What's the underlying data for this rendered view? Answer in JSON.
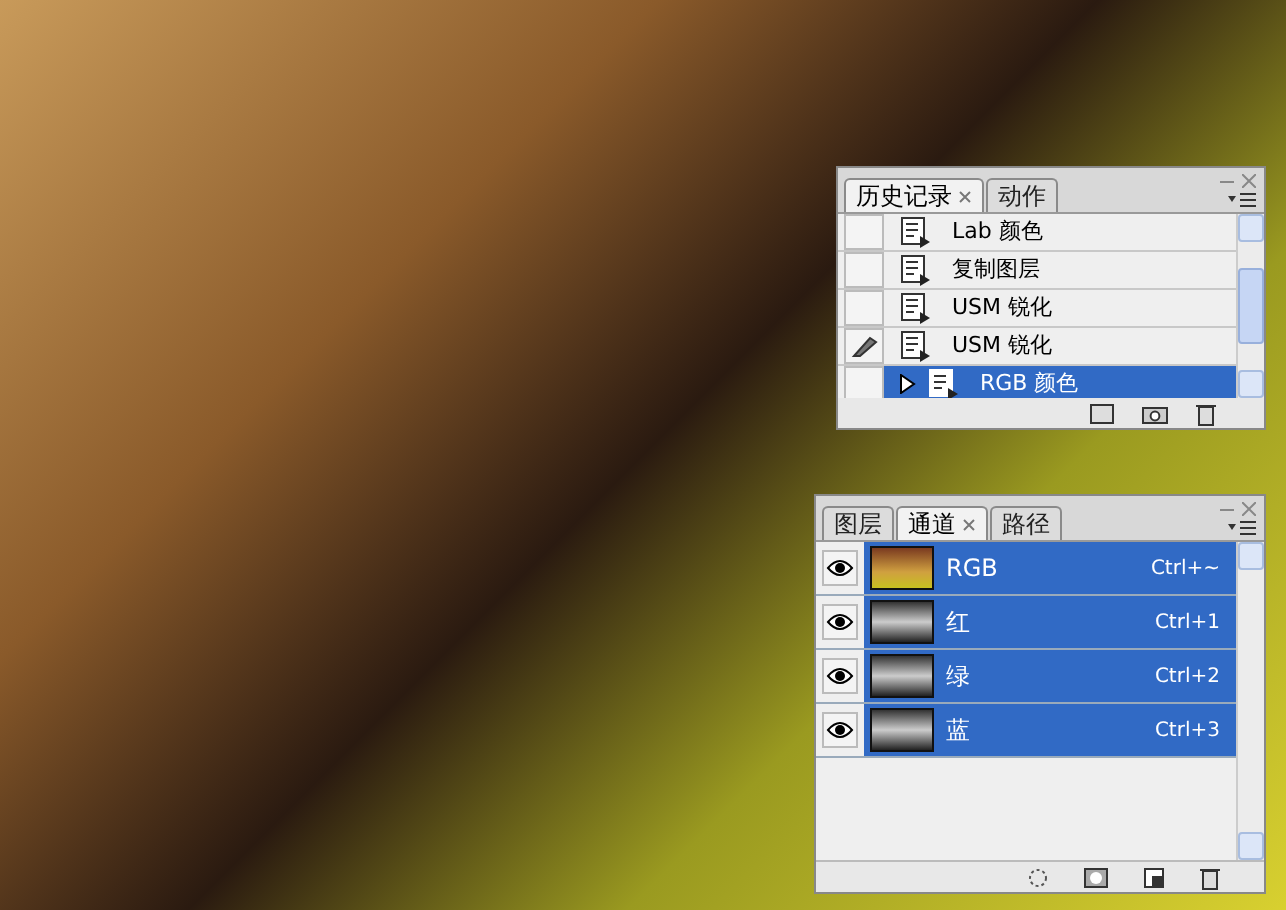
{
  "history_panel": {
    "tabs": [
      {
        "label": "历史记录",
        "selected": true
      },
      {
        "label": "动作",
        "selected": false
      }
    ],
    "items": [
      {
        "label": "Lab 颜色",
        "selected": false,
        "source": false
      },
      {
        "label": "复制图层",
        "selected": false,
        "source": false
      },
      {
        "label": "USM 锐化",
        "selected": false,
        "source": false
      },
      {
        "label": "USM 锐化",
        "selected": false,
        "source": true
      },
      {
        "label": "RGB 颜色",
        "selected": true,
        "source": false
      }
    ]
  },
  "channels_panel": {
    "tabs": [
      {
        "label": "图层",
        "selected": false
      },
      {
        "label": "通道",
        "selected": true
      },
      {
        "label": "路径",
        "selected": false
      }
    ],
    "channels": [
      {
        "name": "RGB",
        "shortcut": "Ctrl+~",
        "visible": true,
        "selected": true
      },
      {
        "name": "红",
        "shortcut": "Ctrl+1",
        "visible": true,
        "selected": true
      },
      {
        "name": "绿",
        "shortcut": "Ctrl+2",
        "visible": true,
        "selected": true
      },
      {
        "name": "蓝",
        "shortcut": "Ctrl+3",
        "visible": true,
        "selected": true
      }
    ]
  }
}
